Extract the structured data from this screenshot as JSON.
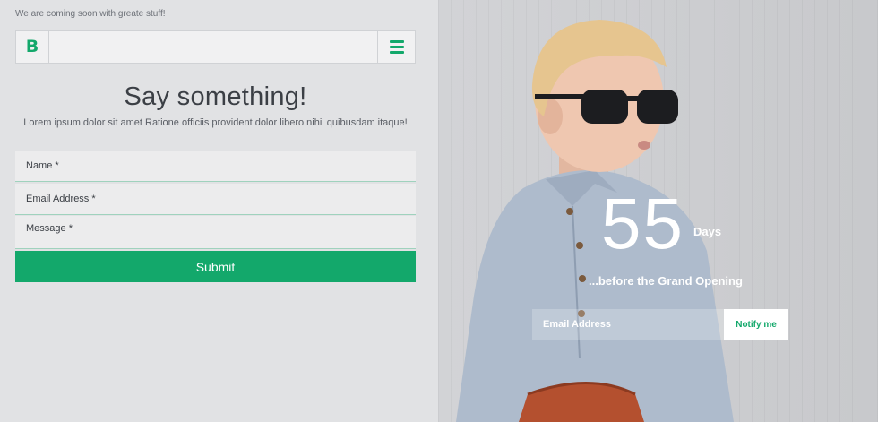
{
  "header": {
    "tagline": "We are coming soon with greate stuff!",
    "logo_text": "B"
  },
  "contact": {
    "title": "Say something!",
    "subtitle": "Lorem ipsum dolor sit amet Ratione officiis provident dolor libero nihil quibusdam itaque!",
    "name_placeholder": "Name *",
    "email_placeholder": "Email Address *",
    "message_placeholder": "Message *",
    "submit_label": "Submit"
  },
  "countdown": {
    "value": "55",
    "unit": "Days",
    "caption": "...before the Grand Opening"
  },
  "notify": {
    "email_placeholder": "Email Address",
    "button_label": "Notify me"
  },
  "colors": {
    "accent": "#13a86b",
    "panel_background": "#e1e2e4"
  },
  "icons": [
    "logo-icon",
    "hamburger-menu-icon"
  ]
}
